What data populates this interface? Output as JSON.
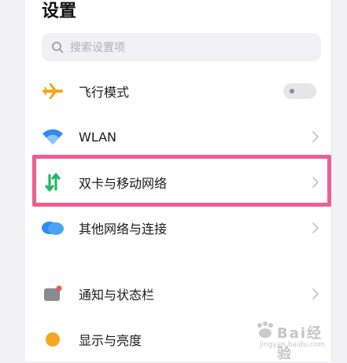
{
  "page": {
    "title": "设置"
  },
  "search": {
    "placeholder": "搜索设置项"
  },
  "rows": [
    {
      "label": "飞行模式",
      "icon": "airplane-icon",
      "control": "toggle",
      "toggle_on": false
    },
    {
      "label": "WLAN",
      "icon": "wifi-icon",
      "control": "chevron"
    },
    {
      "label": "双卡与移动网络",
      "icon": "mobile-network-icon",
      "control": "chevron",
      "highlighted": true
    },
    {
      "label": "其他网络与连接",
      "icon": "cloud-connection-icon",
      "control": "chevron"
    },
    {
      "label": "通知与状态栏",
      "icon": "notification-icon",
      "control": "chevron"
    },
    {
      "label": "显示与亮度",
      "icon": "display-brightness-icon",
      "control": "none"
    }
  ],
  "colors": {
    "highlight_border": "#ee5e8e",
    "airplane": "#f5a623",
    "wifi": "#2f8cf0",
    "mobile_network": "#27b567",
    "cloud": "#2f8cf0",
    "notification": "#8a8a90",
    "display": "#f5a623"
  },
  "watermark": {
    "brand": "Bai经验",
    "url": "jingyan.baidu.com"
  }
}
